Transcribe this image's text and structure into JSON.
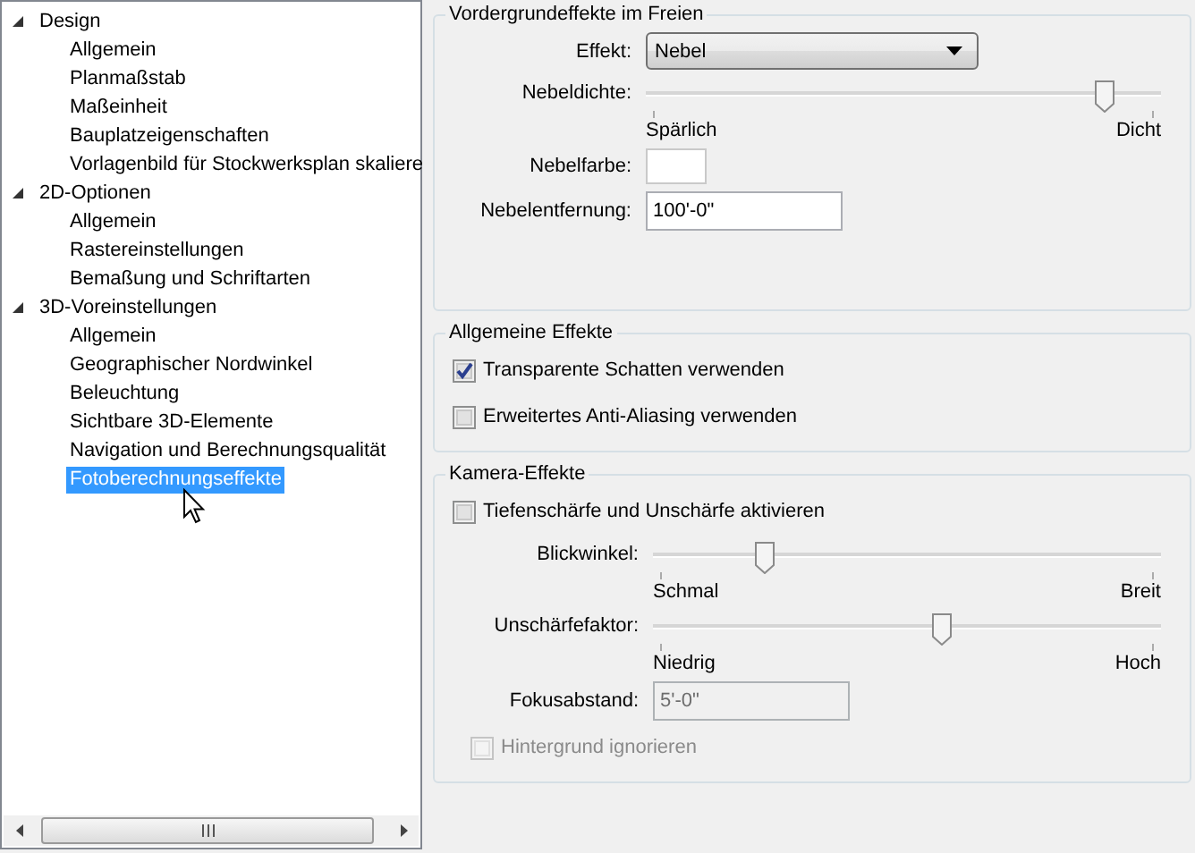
{
  "tree": [
    {
      "label": "Design",
      "expanded": true,
      "children": [
        {
          "label": "Allgemein",
          "selected": false
        },
        {
          "label": "Planmaßstab",
          "selected": false
        },
        {
          "label": "Maßeinheit",
          "selected": false
        },
        {
          "label": "Bauplatzeigenschaften",
          "selected": false
        },
        {
          "label": "Vorlagenbild für Stockwerksplan skaliere",
          "selected": false
        }
      ]
    },
    {
      "label": "2D-Optionen",
      "expanded": true,
      "children": [
        {
          "label": "Allgemein",
          "selected": false
        },
        {
          "label": "Rastereinstellungen",
          "selected": false
        },
        {
          "label": "Bemaßung und Schriftarten",
          "selected": false
        }
      ]
    },
    {
      "label": "3D-Voreinstellungen",
      "expanded": true,
      "children": [
        {
          "label": "Allgemein",
          "selected": false
        },
        {
          "label": "Geographischer Nordwinkel",
          "selected": false
        },
        {
          "label": "Beleuchtung",
          "selected": false
        },
        {
          "label": "Sichtbare 3D-Elemente",
          "selected": false
        },
        {
          "label": "Navigation und Berechnungsqualität",
          "selected": false
        },
        {
          "label": "Fotoberechnungseffekte",
          "selected": true
        }
      ]
    }
  ],
  "sections": [
    {
      "title": "Vordergrundeffekte im Freien",
      "rows": [
        {
          "kind": "dropdown",
          "label": "Effekt:",
          "value": "Nebel"
        },
        {
          "kind": "slider",
          "label": "Nebeldichte:",
          "level": 0.9,
          "min_label": "Spärlich",
          "max_label": "Dicht"
        },
        {
          "kind": "color",
          "label": "Nebelfarbe:",
          "color": "#ffffff"
        },
        {
          "kind": "text",
          "label": "Nebelentfernung:",
          "value": "100'-0\"",
          "disabled": false
        }
      ]
    },
    {
      "title": "Allgemeine Effekte",
      "rows": [
        {
          "kind": "checkbox",
          "label": "Transparente Schatten verwenden",
          "checked": true,
          "disabled": false
        },
        {
          "kind": "checkbox",
          "label": "Erweitertes Anti-Aliasing verwenden",
          "checked": false,
          "disabled": false
        }
      ]
    },
    {
      "title": "Kamera-Effekte",
      "rows": [
        {
          "kind": "checkbox",
          "label": "Tiefenschärfe und Unschärfe aktivieren",
          "checked": false,
          "disabled": false
        },
        {
          "kind": "slider",
          "label": "Blickwinkel:",
          "level": 0.21,
          "min_label": "Schmal",
          "max_label": "Breit"
        },
        {
          "kind": "slider",
          "label": "Unschärfefaktor:",
          "level": 0.57,
          "min_label": "Niedrig",
          "max_label": "Hoch"
        },
        {
          "kind": "text",
          "label": "Fokusabstand:",
          "value": "5'-0\"",
          "disabled": true
        },
        {
          "kind": "checkbox",
          "label": "Hintergrund ignorieren",
          "checked": false,
          "disabled": true
        }
      ]
    }
  ]
}
